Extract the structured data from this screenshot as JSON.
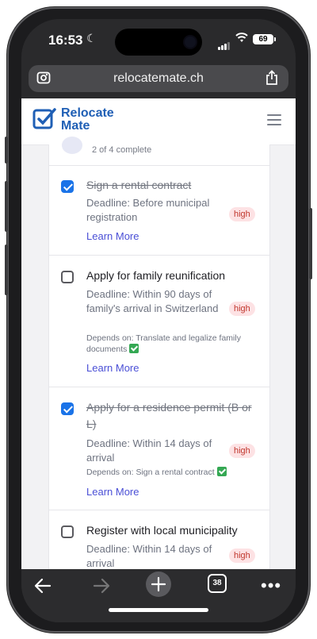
{
  "status_bar": {
    "time": "16:53",
    "battery": "69"
  },
  "browser": {
    "url": "relocatemate.ch",
    "tab_count": "38"
  },
  "brand": {
    "line1": "Relocate",
    "line2": "Mate"
  },
  "progress": {
    "text": "2 of 4 complete"
  },
  "tasks": [
    {
      "title": "Sign a rental contract",
      "completed": true,
      "deadline": "Deadline: Before municipal registration",
      "priority": "high",
      "learn_more": "Learn More"
    },
    {
      "title": "Apply for family reunification",
      "completed": false,
      "deadline": "Deadline: Within 90 days of family's arrival in Switzerland",
      "depends_on": "Depends on: Translate and legalize family documents",
      "priority": "high",
      "learn_more": "Learn More"
    },
    {
      "title": "Apply for a residence permit (B or L)",
      "completed": true,
      "deadline": "Deadline: Within 14 days of arrival",
      "depends_on": "Depends on: Sign a rental contract",
      "priority": "high",
      "learn_more": "Learn More"
    },
    {
      "title": "Register with local municipality",
      "completed": false,
      "deadline": "Deadline: Within 14 days of arrival",
      "priority": "high"
    }
  ],
  "colors": {
    "accent": "#1a73e8",
    "brand": "#1f5fb5",
    "badge_bg": "#fde2e4",
    "badge_text": "#c0362c",
    "link": "#4a4fd6"
  }
}
